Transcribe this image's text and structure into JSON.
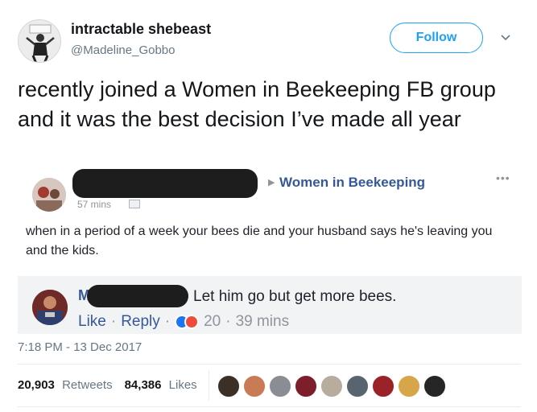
{
  "author": {
    "display_name": "intractable shebeast",
    "handle": "@Madeline_Gobbo"
  },
  "follow_label": "Follow",
  "tweet_text": "recently joined a Women in Beekeeping FB group and it was the best decision I’ve made all year",
  "facebook_post": {
    "group_name": "Women in Beekeeping",
    "time_partial": "57 mins",
    "more_label": "•••",
    "body": "when in a period of a week your bees die and your husband says he's leaving you and the kids."
  },
  "facebook_comment": {
    "name_initial": "M",
    "text": "Let him go but get more bees.",
    "like_label": "Like",
    "reply_label": "Reply",
    "reaction_count": "20",
    "age": "39 mins"
  },
  "timestamp": "7:18 PM - 13 Dec 2017",
  "stats": {
    "retweets_count": "20,903",
    "retweets_label": "Retweets",
    "likes_count": "84,386",
    "likes_label": "Likes"
  },
  "colors": {
    "twitter_blue": "#1da1f2",
    "facebook_blue": "#365899"
  },
  "liker_colors": [
    "#3b3028",
    "#c97b55",
    "#8a8d93",
    "#7c1f2a",
    "#b7ad9e",
    "#5a6470",
    "#9c2229",
    "#d7a64a",
    "#262626"
  ]
}
